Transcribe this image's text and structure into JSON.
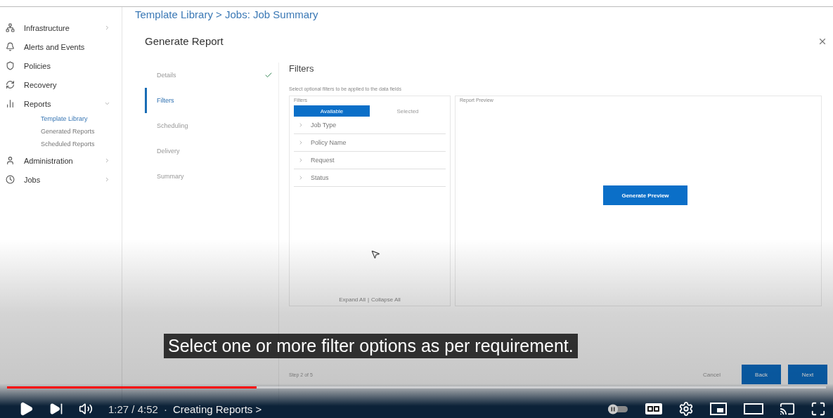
{
  "breadcrumb": "Template Library > Jobs: Job Summary",
  "sidebar": {
    "items": [
      {
        "label": "Infrastructure",
        "expanded": false
      },
      {
        "label": "Alerts and Events"
      },
      {
        "label": "Policies"
      },
      {
        "label": "Recovery"
      },
      {
        "label": "Reports",
        "expanded": true,
        "children": [
          {
            "label": "Template Library",
            "selected": true
          },
          {
            "label": "Generated Reports",
            "selected": false
          },
          {
            "label": "Scheduled Reports",
            "selected": false
          }
        ]
      },
      {
        "label": "Administration",
        "expanded": false
      },
      {
        "label": "Jobs",
        "expanded": false
      }
    ]
  },
  "dialog": {
    "title": "Generate Report",
    "steps": [
      {
        "label": "Details",
        "completed": true,
        "selected": false
      },
      {
        "label": "Filters",
        "completed": false,
        "selected": true
      },
      {
        "label": "Scheduling",
        "completed": false,
        "selected": false
      },
      {
        "label": "Delivery",
        "completed": false,
        "selected": false
      },
      {
        "label": "Summary",
        "completed": false,
        "selected": false
      }
    ],
    "heading": "Filters",
    "description": "Select optional filters to be applied to the data fields",
    "filters_panel": {
      "title": "Filters",
      "tabs": [
        {
          "label": "Available",
          "selected": true
        },
        {
          "label": "Selected",
          "selected": false
        }
      ],
      "rows": [
        {
          "label": "Job Type",
          "expanded": false
        },
        {
          "label": "Policy Name",
          "expanded": false
        },
        {
          "label": "Request",
          "expanded": false
        },
        {
          "label": "Status",
          "expanded": false
        }
      ],
      "expand_all": "Expand All",
      "link_separator": "|",
      "collapse_all": "Collapse All"
    },
    "preview_panel": {
      "title": "Report Preview",
      "button": "Generate Preview"
    },
    "step_counter": "Step 2 of 5",
    "buttons": {
      "cancel": "Cancel",
      "back": "Back",
      "next": "Next"
    }
  },
  "caption": "Select one or more filter options as per requirement.",
  "player": {
    "progress": {
      "level": 0.305
    },
    "time": "1:27 / 4:52",
    "chapter_separator": "·",
    "chapter": "Creating Reports",
    "chapter_arrow": ">",
    "autoplay_on": false,
    "captions_on": true
  }
}
